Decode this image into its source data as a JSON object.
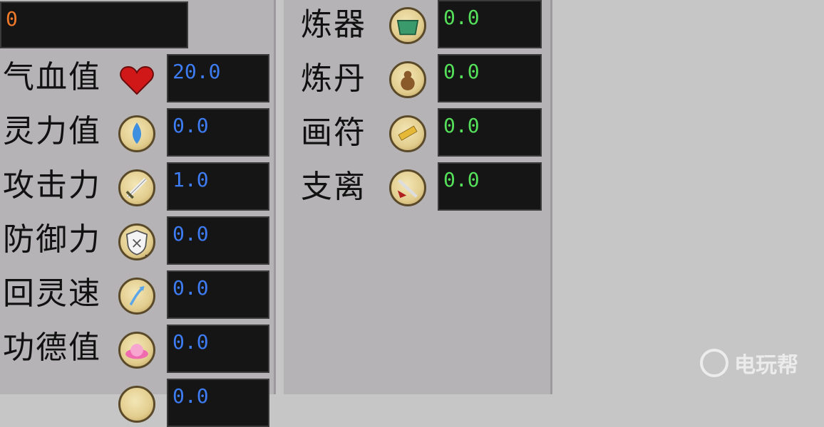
{
  "top_field": {
    "value": "0"
  },
  "left_stats": [
    {
      "label": "气血值",
      "icon": "heart-hp-icon",
      "tag": "HP",
      "value": "20.0"
    },
    {
      "label": "灵力值",
      "icon": "spirit-mp-icon",
      "tag": "MP",
      "value": "0.0"
    },
    {
      "label": "攻击力",
      "icon": "sword-atk-icon",
      "tag": "ATT",
      "value": "1.0"
    },
    {
      "label": "防御力",
      "icon": "shield-def-icon",
      "tag": "DEF",
      "value": "0.0"
    },
    {
      "label": "回灵速",
      "icon": "regen-arrow-icon",
      "tag": "",
      "value": "0.0"
    },
    {
      "label": "功德值",
      "icon": "lotus-merit-icon",
      "tag": "",
      "value": "0.0"
    },
    {
      "label": "",
      "icon": "star-icon",
      "tag": "",
      "value": "0.0"
    }
  ],
  "right_skills": [
    {
      "label": "炼器",
      "icon": "cauldron-icon",
      "value": "0.0"
    },
    {
      "label": "炼丹",
      "icon": "gourd-icon",
      "value": "0.0"
    },
    {
      "label": "画符",
      "icon": "talisman-icon",
      "value": "0.0"
    },
    {
      "label": "支离",
      "icon": "dagger-icon",
      "value": "0.0"
    }
  ],
  "colors": {
    "stat_value": "#3d7cf2",
    "skill_value": "#55e05a",
    "top_value": "#f07a2a"
  },
  "watermark": {
    "text": "电玩帮"
  }
}
